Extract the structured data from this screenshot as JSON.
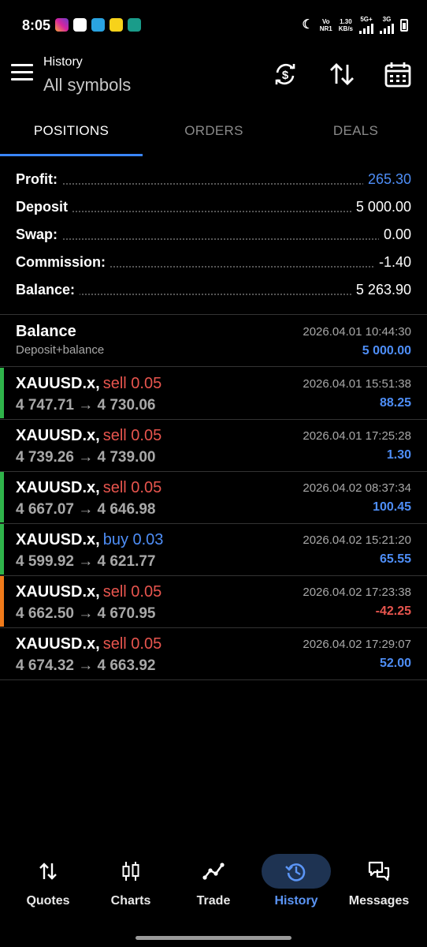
{
  "status_bar": {
    "time": "8:05",
    "net_top": "Vo",
    "net_bottom": "NR1",
    "speed_top": "1.30",
    "speed_bottom": "KB/s",
    "sig1_label": "5G+",
    "sig2_label": "3G"
  },
  "header": {
    "title": "History",
    "subtitle": "All symbols"
  },
  "tabs": [
    {
      "label": "POSITIONS",
      "active": true
    },
    {
      "label": "ORDERS",
      "active": false
    },
    {
      "label": "DEALS",
      "active": false
    }
  ],
  "summary": {
    "profit": {
      "label": "Profit:",
      "value": "265.30"
    },
    "deposit": {
      "label": "Deposit",
      "value": "5 000.00"
    },
    "swap": {
      "label": "Swap:",
      "value": "0.00"
    },
    "commission": {
      "label": "Commission:",
      "value": "-1.40"
    },
    "balance": {
      "label": "Balance:",
      "value": "5 263.90"
    }
  },
  "balance_entry": {
    "title": "Balance",
    "subtitle": "Deposit+balance",
    "time": "2026.04.01 10:44:30",
    "amount": "5 000.00"
  },
  "positions": [
    {
      "symbol": "XAUUSD.x,",
      "side": "sell 0.05",
      "prices": "4 747.71 → 4 730.06",
      "time": "2026.04.01 15:51:38",
      "profit": "88.25",
      "marker": "#2fb34a"
    },
    {
      "symbol": "XAUUSD.x,",
      "side": "sell 0.05",
      "prices": "4 739.26 → 4 739.00",
      "time": "2026.04.01 17:25:28",
      "profit": "1.30",
      "marker": ""
    },
    {
      "symbol": "XAUUSD.x,",
      "side": "sell 0.05",
      "prices": "4 667.07 → 4 646.98",
      "time": "2026.04.02 08:37:34",
      "profit": "100.45",
      "marker": "#2fb34a"
    },
    {
      "symbol": "XAUUSD.x,",
      "side": "buy 0.03",
      "prices": "4 599.92 → 4 621.77",
      "time": "2026.04.02 15:21:20",
      "profit": "65.55",
      "marker": "#2fb34a"
    },
    {
      "symbol": "XAUUSD.x,",
      "side": "sell 0.05",
      "prices": "4 662.50 → 4 670.95",
      "time": "2026.04.02 17:23:38",
      "profit": "-42.25",
      "marker": "#f07a1a"
    },
    {
      "symbol": "XAUUSD.x,",
      "side": "sell 0.05",
      "prices": "4 674.32 → 4 663.92",
      "time": "2026.04.02 17:29:07",
      "profit": "52.00",
      "marker": ""
    }
  ],
  "bottom_nav": [
    {
      "label": "Quotes",
      "icon": "quotes-arrows-icon",
      "active": false
    },
    {
      "label": "Charts",
      "icon": "charts-candles-icon",
      "active": false
    },
    {
      "label": "Trade",
      "icon": "trade-line-icon",
      "active": false
    },
    {
      "label": "History",
      "icon": "history-clock-icon",
      "active": true
    },
    {
      "label": "Messages",
      "icon": "messages-bubbles-icon",
      "active": false
    }
  ],
  "colors": {
    "background": "#000000",
    "accent": "#3a86ff",
    "sell": "#e8554e",
    "buy": "#4e8ef7",
    "profit_positive": "#4e8ef7",
    "profit_negative": "#e8554e"
  }
}
